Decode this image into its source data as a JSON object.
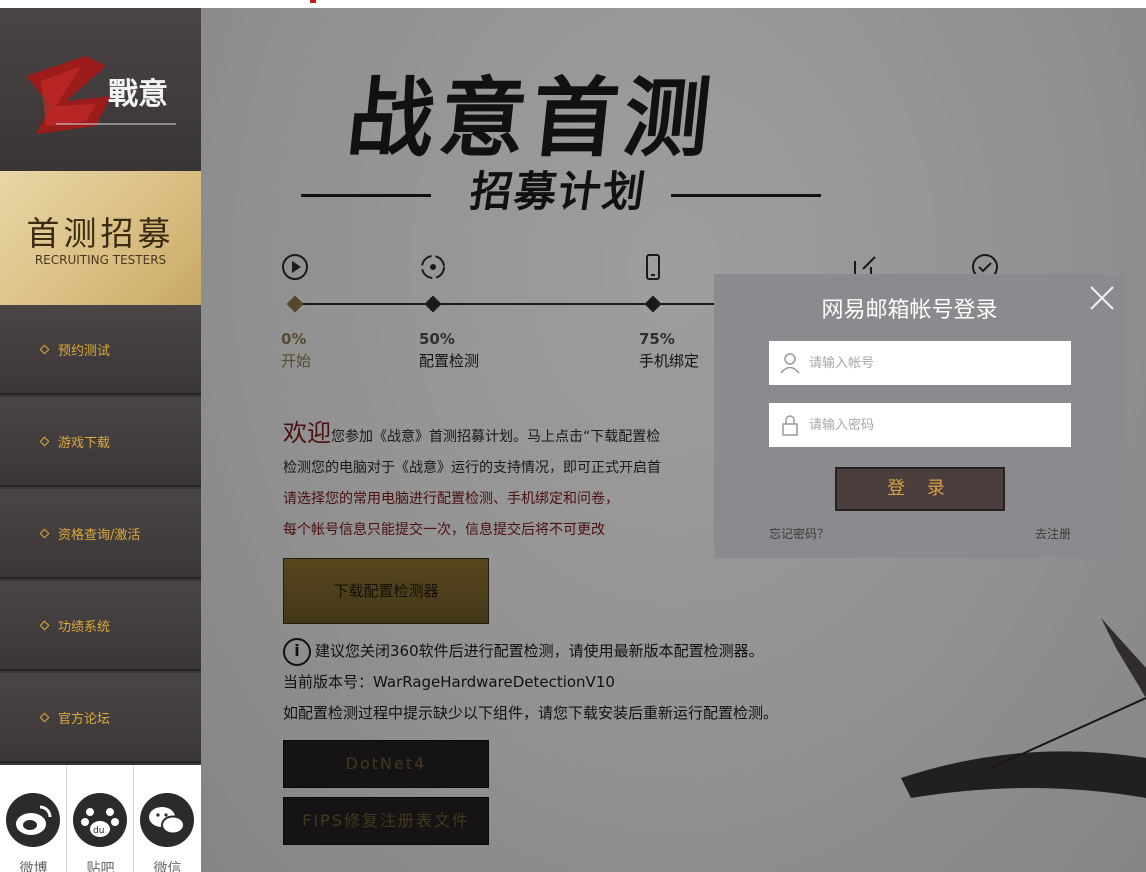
{
  "sidebar": {
    "recruit_title": "首测招募",
    "recruit_sub": "RECRUITING TESTERS",
    "nav": [
      {
        "label": "预约测试"
      },
      {
        "label": "游戏下载"
      },
      {
        "label": "资格查询/激活"
      },
      {
        "label": "功绩系统"
      },
      {
        "label": "官方论坛"
      }
    ],
    "social": [
      {
        "label": "微博",
        "icon": "weibo-icon"
      },
      {
        "label": "贴吧",
        "icon": "tieba-icon"
      },
      {
        "label": "微信",
        "icon": "wechat-icon"
      }
    ]
  },
  "hero": {
    "title": "战意首测",
    "subtitle": "招募计划"
  },
  "progress": {
    "steps": [
      {
        "pct": "0%",
        "name": "开始",
        "icon": "play-icon"
      },
      {
        "pct": "50%",
        "name": "配置检测",
        "icon": "config-icon"
      },
      {
        "pct": "75%",
        "name": "手机绑定",
        "icon": "phone-icon"
      },
      {
        "pct": "",
        "name": "",
        "icon": "edit-icon"
      },
      {
        "pct": "",
        "name": "",
        "icon": "check-icon"
      }
    ]
  },
  "welcome": {
    "big": "欢迎",
    "line1": "您参加《战意》首测招募计划。马上点击“下载配置检",
    "line2": "检测您的电脑对于《战意》运行的支持情况，即可正式开启首",
    "red1": "请选择您的常用电脑进行配置检测、手机绑定和问卷，",
    "red2": "每个帐号信息只能提交一次，信息提交后将不可更改"
  },
  "download": {
    "button": "下载配置检测器",
    "tip": "建议您关闭360软件后进行配置检测，请使用最新版本配置检测器。",
    "version": "当前版本号：WarRageHardwareDetectionV10",
    "components_note": "如配置检测过程中提示缺少以下组件，请您下载安装后重新运行配置检测。",
    "dotnet": "DotNet4",
    "fips": "FIPS修复注册表文件"
  },
  "login": {
    "title": "网易邮箱帐号登录",
    "account_placeholder": "请输入帐号",
    "password_placeholder": "请输入密码",
    "login_button": "登 录",
    "forgot": "忘记密码？",
    "register": "去注册"
  }
}
